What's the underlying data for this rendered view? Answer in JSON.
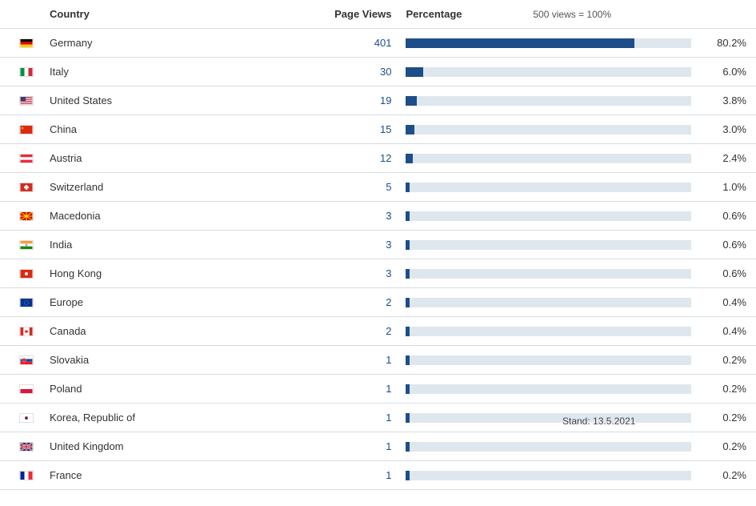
{
  "headers": {
    "country": "Country",
    "views": "Page Views",
    "percentage": "Percentage",
    "note": "500 views = 100%"
  },
  "stand": "Stand: 13.5.2021",
  "rows": [
    {
      "country": "Germany",
      "views": 401,
      "pct": "80.2%",
      "bar": 80.2,
      "flag": "de"
    },
    {
      "country": "Italy",
      "views": 30,
      "pct": "6.0%",
      "bar": 6.0,
      "flag": "it"
    },
    {
      "country": "United States",
      "views": 19,
      "pct": "3.8%",
      "bar": 3.8,
      "flag": "us"
    },
    {
      "country": "China",
      "views": 15,
      "pct": "3.0%",
      "bar": 3.0,
      "flag": "cn"
    },
    {
      "country": "Austria",
      "views": 12,
      "pct": "2.4%",
      "bar": 2.4,
      "flag": "at"
    },
    {
      "country": "Switzerland",
      "views": 5,
      "pct": "1.0%",
      "bar": 1.0,
      "flag": "ch"
    },
    {
      "country": "Macedonia",
      "views": 3,
      "pct": "0.6%",
      "bar": 0.6,
      "flag": "mk"
    },
    {
      "country": "India",
      "views": 3,
      "pct": "0.6%",
      "bar": 0.6,
      "flag": "in"
    },
    {
      "country": "Hong Kong",
      "views": 3,
      "pct": "0.6%",
      "bar": 0.6,
      "flag": "hk"
    },
    {
      "country": "Europe",
      "views": 2,
      "pct": "0.4%",
      "bar": 0.4,
      "flag": "eu"
    },
    {
      "country": "Canada",
      "views": 2,
      "pct": "0.4%",
      "bar": 0.4,
      "flag": "ca"
    },
    {
      "country": "Slovakia",
      "views": 1,
      "pct": "0.2%",
      "bar": 0.2,
      "flag": "sk"
    },
    {
      "country": "Poland",
      "views": 1,
      "pct": "0.2%",
      "bar": 0.2,
      "flag": "pl"
    },
    {
      "country": "Korea, Republic of",
      "views": 1,
      "pct": "0.2%",
      "bar": 0.2,
      "flag": "kr"
    },
    {
      "country": "United Kingdom",
      "views": 1,
      "pct": "0.2%",
      "bar": 0.2,
      "flag": "gb"
    },
    {
      "country": "France",
      "views": 1,
      "pct": "0.2%",
      "bar": 0.2,
      "flag": "fr"
    }
  ],
  "chart_data": {
    "type": "bar",
    "title": "Page Views by Country",
    "xlabel": "Country",
    "ylabel": "Page Views",
    "note": "500 views = 100%",
    "categories": [
      "Germany",
      "Italy",
      "United States",
      "China",
      "Austria",
      "Switzerland",
      "Macedonia",
      "India",
      "Hong Kong",
      "Europe",
      "Canada",
      "Slovakia",
      "Poland",
      "Korea, Republic of",
      "United Kingdom",
      "France"
    ],
    "values": [
      401,
      30,
      19,
      15,
      12,
      5,
      3,
      3,
      3,
      2,
      2,
      1,
      1,
      1,
      1,
      1
    ],
    "percentages": [
      80.2,
      6.0,
      3.8,
      3.0,
      2.4,
      1.0,
      0.6,
      0.6,
      0.6,
      0.4,
      0.4,
      0.2,
      0.2,
      0.2,
      0.2,
      0.2
    ],
    "ylim": [
      0,
      500
    ]
  }
}
